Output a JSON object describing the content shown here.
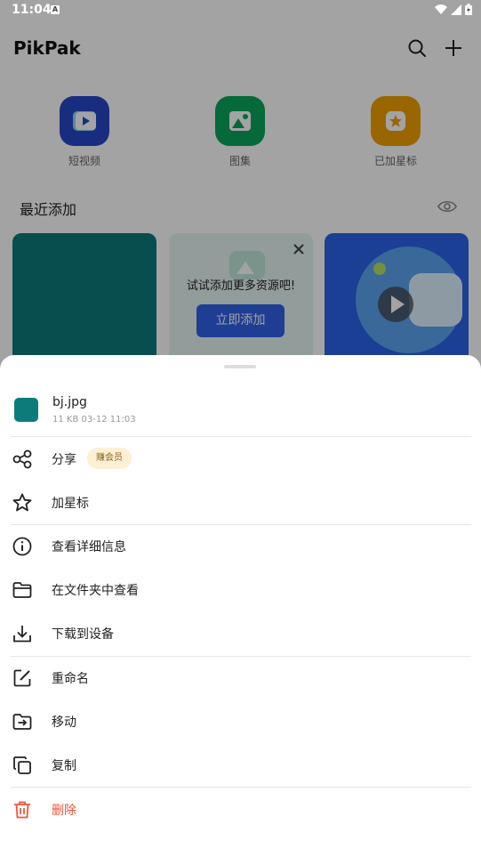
{
  "status_bar": {
    "time": "11:04",
    "notification_icon": "A"
  },
  "app": {
    "title": "PikPak",
    "quick_access": [
      {
        "label": "短视频",
        "icon": "video-icon",
        "color": "#2647c8"
      },
      {
        "label": "图集",
        "icon": "image-icon",
        "color": "#0aa55a"
      },
      {
        "label": "已加星标",
        "icon": "star-icon",
        "color": "#f0a000"
      }
    ],
    "recent_title": "最近添加",
    "promo": {
      "text": "试试添加更多资源吧!",
      "button": "立即添加"
    }
  },
  "sheet": {
    "file": {
      "name": "bj.jpg",
      "meta": "11 KB 03-12 11:03",
      "thumb_color": "#0e7b7b"
    },
    "items": [
      {
        "label": "分享",
        "badge": "赚会员",
        "icon": "share-icon"
      },
      {
        "label": "加星标",
        "icon": "star-outline-icon"
      },
      {
        "label": "查看详细信息",
        "icon": "info-icon"
      },
      {
        "label": "在文件夹中查看",
        "icon": "folder-icon"
      },
      {
        "label": "下载到设备",
        "icon": "download-icon"
      },
      {
        "label": "重命名",
        "icon": "rename-icon"
      },
      {
        "label": "移动",
        "icon": "move-icon"
      },
      {
        "label": "复制",
        "icon": "copy-icon"
      },
      {
        "label": "删除",
        "icon": "trash-icon",
        "color": "#f0553b"
      }
    ]
  }
}
